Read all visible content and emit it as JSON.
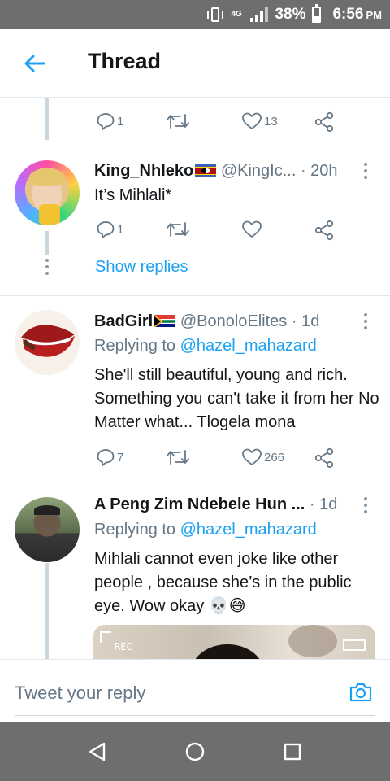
{
  "status_bar": {
    "network": "4G",
    "battery": "38%",
    "battery_level": 0.38,
    "time": "6:56",
    "ampm": "PM"
  },
  "header": {
    "title": "Thread"
  },
  "top_actions": {
    "reply_count": "1",
    "like_count": "13"
  },
  "tweets": [
    {
      "name": "King_Nhleko",
      "handle": "@KingIc...",
      "time": "· 20h",
      "text": "It’s Mihlali*",
      "reply_count": "1",
      "like_count": "",
      "show_replies": "Show replies"
    },
    {
      "name": "BadGirl",
      "handle": "@BonoloElites",
      "time": "· 1d",
      "replying_label": "Replying to",
      "replying_to": "@hazel_mahazard",
      "text": "She'll still beautiful, young and rich. Something you can't take it from her No Matter what... Tlogela mona",
      "reply_count": "7",
      "like_count": "266"
    },
    {
      "name": "A Peng Zim Ndebele Hun ...",
      "time": "· 1d",
      "replying_label": "Replying to",
      "replying_to": "@hazel_mahazard",
      "text": "Mihlali cannot even joke like other people , because she’s in the public eye. Wow okay 💀😅"
    }
  ],
  "reply_bar": {
    "placeholder": "Tweet your reply"
  },
  "colors": {
    "accent": "#1da1f2",
    "secondary_text": "#657786",
    "system_bar": "#6e6e6e"
  },
  "icons": [
    "back-arrow-icon",
    "reply-icon",
    "retweet-icon",
    "like-icon",
    "share-icon",
    "more-icon",
    "camera-icon",
    "nav-back-icon",
    "nav-home-icon",
    "nav-recents-icon"
  ]
}
